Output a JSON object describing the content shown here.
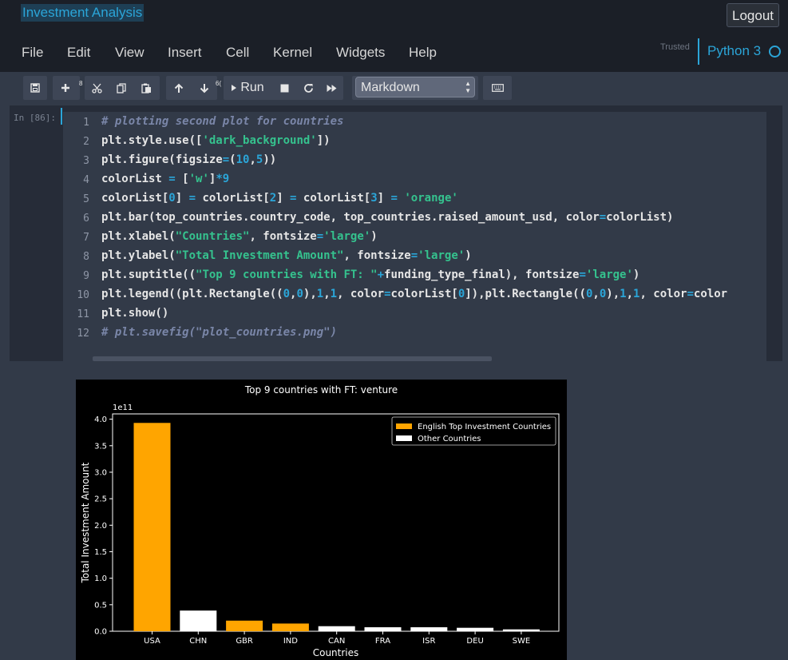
{
  "header": {
    "title": "Investment Analysis",
    "logout_label": "Logout",
    "trusted_label": "Trusted",
    "kernel_name": "Python 3"
  },
  "menu": [
    "File",
    "Edit",
    "View",
    "Insert",
    "Cell",
    "Kernel",
    "Widgets",
    "Help"
  ],
  "toolbar": {
    "run_label": "Run",
    "cell_type": "Markdown"
  },
  "cell": {
    "prompt": "In [86]:",
    "line_numbers": [
      "1",
      "2",
      "3",
      "4",
      "5",
      "6",
      "7",
      "8",
      "9",
      "10",
      "11",
      "12"
    ],
    "code_lines": [
      "# plotting second plot for countries",
      "plt.style.use(['dark_background'])",
      "plt.figure(figsize=(10,5))",
      "colorList = ['w']*9",
      "colorList[0] = colorList[2] = colorList[3] = 'orange'",
      "plt.bar(top_countries.country_code, top_countries.raised_amount_usd, color=colorList)",
      "plt.xlabel(\"Countries\", fontsize='large')",
      "plt.ylabel(\"Total Investment Amount\", fontsize='large')",
      "plt.suptitle((\"Top 9 countries with FT: \"+funding_type_final), fontsize='large')",
      "plt.legend((plt.Rectangle((0,0),1,1, color=colorList[0]),plt.Rectangle((0,0),1,1, color=color",
      "plt.show()",
      "# plt.savefig(\"plot_countries.png\")"
    ]
  },
  "chart_data": {
    "type": "bar",
    "title": "Top 9 countries with FT: venture",
    "xlabel": "Countries",
    "ylabel": "Total Investment Amount",
    "offset_text": "1e11",
    "categories": [
      "USA",
      "CHN",
      "GBR",
      "IND",
      "CAN",
      "FRA",
      "ISR",
      "DEU",
      "SWE"
    ],
    "values": [
      3.93,
      0.39,
      0.2,
      0.145,
      0.095,
      0.075,
      0.075,
      0.065,
      0.035
    ],
    "bar_colors": [
      "#ffa500",
      "#ffffff",
      "#ffa500",
      "#ffa500",
      "#ffffff",
      "#ffffff",
      "#ffffff",
      "#ffffff",
      "#ffffff"
    ],
    "ylim": [
      0,
      4.1
    ],
    "yticks": [
      "0.0",
      "0.5",
      "1.0",
      "1.5",
      "2.0",
      "2.5",
      "3.0",
      "3.5",
      "4.0"
    ],
    "legend": [
      {
        "label": "English Top Investment Countries",
        "color": "#ffa500"
      },
      {
        "label": "Other Countries",
        "color": "#ffffff"
      }
    ],
    "legend_position": "top-right",
    "grid": false
  }
}
